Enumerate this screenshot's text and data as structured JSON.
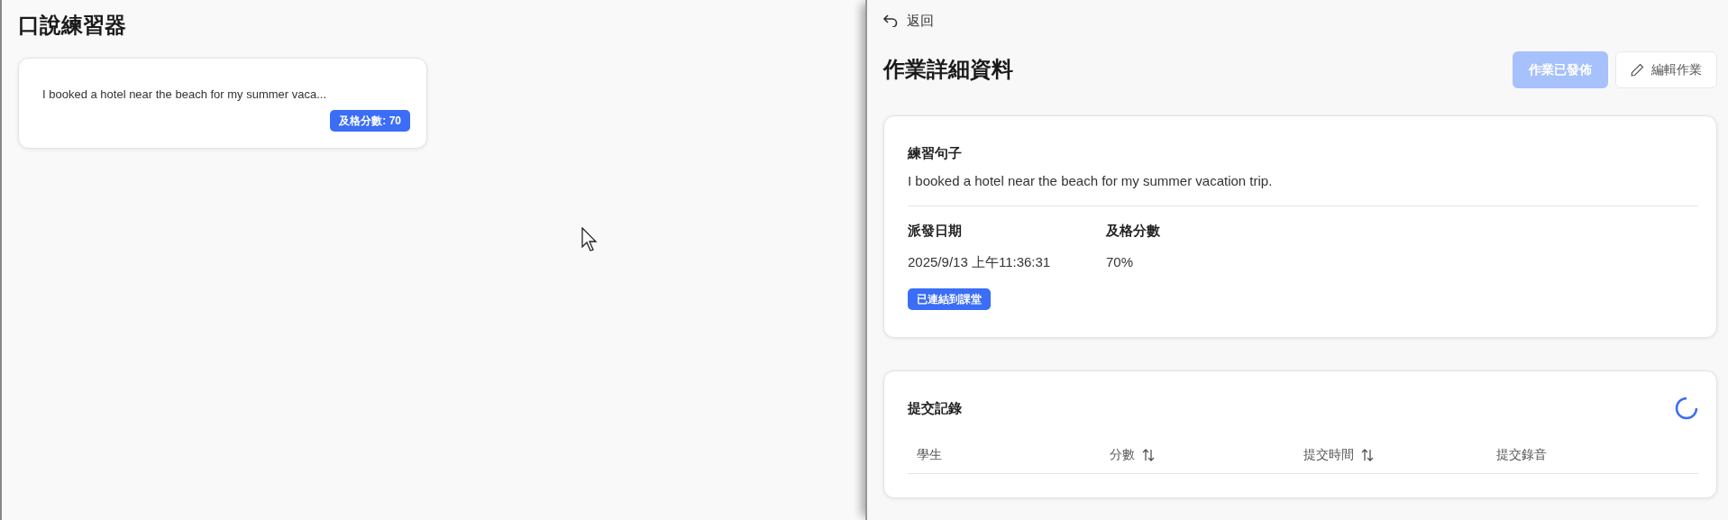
{
  "left_panel": {
    "title": "口說練習器",
    "items": [
      {
        "sentence": "I booked a hotel near the beach for my summer vaca...",
        "badge": "及格分數: 70"
      }
    ]
  },
  "detail": {
    "back_label": "返回",
    "title": "作業詳細資料",
    "buttons": [
      {
        "label": "作業已發佈",
        "kind": "primary",
        "disabled": true
      },
      {
        "label": "編輯作業",
        "kind": "edit",
        "disabled": false
      }
    ],
    "sentence_card": {
      "heading": "練習句子",
      "sentence": "I booked a hotel near the beach for my summer vacation trip.",
      "fields": [
        {
          "label": "派發日期",
          "value": "2025/9/13 上午11:36:31"
        },
        {
          "label": "及格分數",
          "value": "70%"
        }
      ],
      "tag": "已連結到課堂"
    },
    "submissions": {
      "title": "提交記錄",
      "loading": true,
      "columns": [
        {
          "label": "學生",
          "sortable": false
        },
        {
          "label": "分數",
          "sortable": true
        },
        {
          "label": "提交時間",
          "sortable": true
        },
        {
          "label": "提交錄音",
          "sortable": false
        }
      ]
    }
  }
}
